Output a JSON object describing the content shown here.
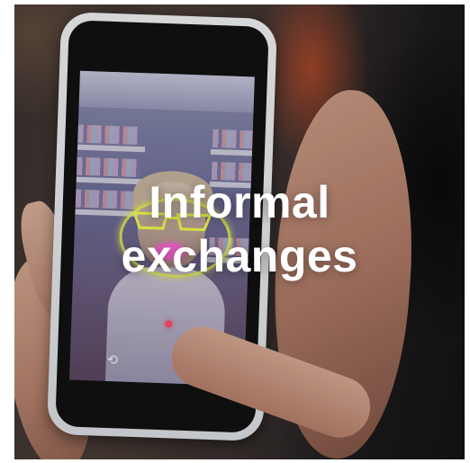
{
  "card": {
    "title_line1": "Informal",
    "title_line2": "exchanges",
    "image": {
      "icon_camera_switch": "camera-switch-icon"
    },
    "colors": {
      "title_text": "#ffffff",
      "phone_case": "#f4f5f7",
      "neon_glasses": "#f4ff4d",
      "neon_lips": "#ff6bd6"
    }
  }
}
